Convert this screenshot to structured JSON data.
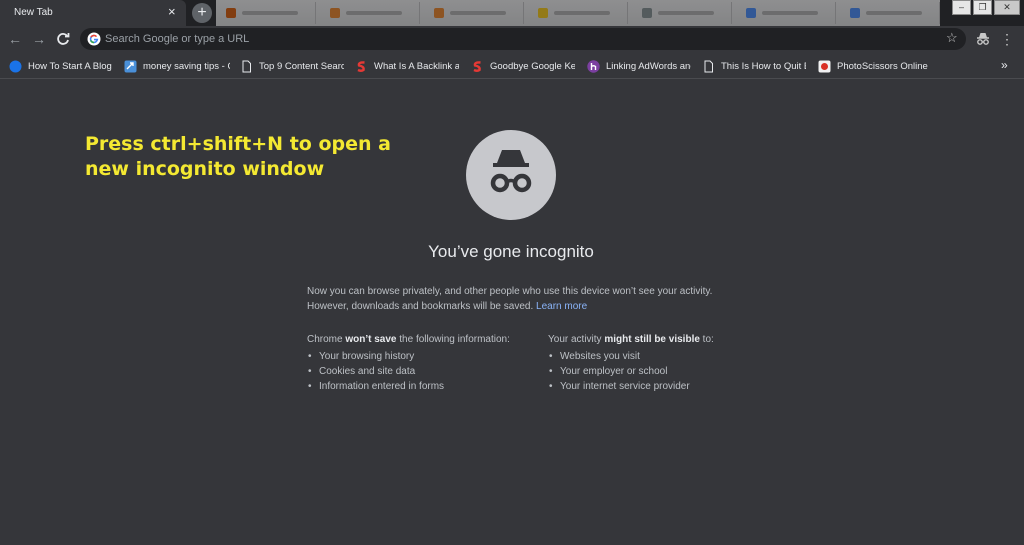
{
  "tabs": {
    "active": {
      "title": "New Tab",
      "close": "×"
    },
    "new_tab": "+",
    "background_tab_colors": [
      "#d35400",
      "#e67e22",
      "#e67e22",
      "#f1c40f",
      "#7f8c8d",
      "#4285f4",
      "#4285f4"
    ]
  },
  "window_controls": {
    "minimize": "–",
    "restore": "❐",
    "close": "✕"
  },
  "toolbar": {
    "back": "←",
    "forward": "→",
    "reload": "C",
    "omnibox_placeholder": "Search Google or type a URL",
    "star": "☆",
    "menu": "⋮"
  },
  "bookmarks": {
    "items": [
      {
        "label": "How To Start A Blog",
        "icon": "blue-circle-icon",
        "color": "#1a73e8"
      },
      {
        "label": "money saving tips - C",
        "icon": "share-icon",
        "color": "#4a90d9"
      },
      {
        "label": "Top 9 Content Searcl",
        "icon": "page-icon",
        "color": "#e8eaed"
      },
      {
        "label": "What Is A Backlink ar",
        "icon": "red-s-icon",
        "color": "#e53935"
      },
      {
        "label": "Goodbye Google Key",
        "icon": "red-s-icon",
        "color": "#e53935"
      },
      {
        "label": "Linking AdWords anc",
        "icon": "purple-h-icon",
        "color": "#7b3fa0"
      },
      {
        "label": "This Is How to Quit B",
        "icon": "page-icon",
        "color": "#e8eaed"
      },
      {
        "label": "PhotoScissors Online",
        "icon": "photoscissors-icon",
        "color": "#d93025"
      }
    ],
    "more": "»"
  },
  "annotation": {
    "text": "Press ctrl+shift+N to open a new incognito window",
    "color": "#f4e932"
  },
  "incognito": {
    "headline": "You’ve gone incognito",
    "description": "Now you can browse privately, and other people who use this device won’t see your activity. However, downloads and bookmarks will be saved.",
    "learn_more": "Learn more",
    "wont_save": {
      "prefix": "Chrome ",
      "bold": "won’t save",
      "suffix": " the following information:",
      "items": [
        "Your browsing history",
        "Cookies and site data",
        "Information entered in forms"
      ]
    },
    "might_be_visible": {
      "prefix": "Your activity ",
      "bold": "might still be visible",
      "suffix": " to:",
      "items": [
        "Websites you visit",
        "Your employer or school",
        "Your internet service provider"
      ]
    }
  },
  "colors": {
    "background": "#35363a",
    "tabstrip": "#202124",
    "link": "#8ab4f8"
  }
}
